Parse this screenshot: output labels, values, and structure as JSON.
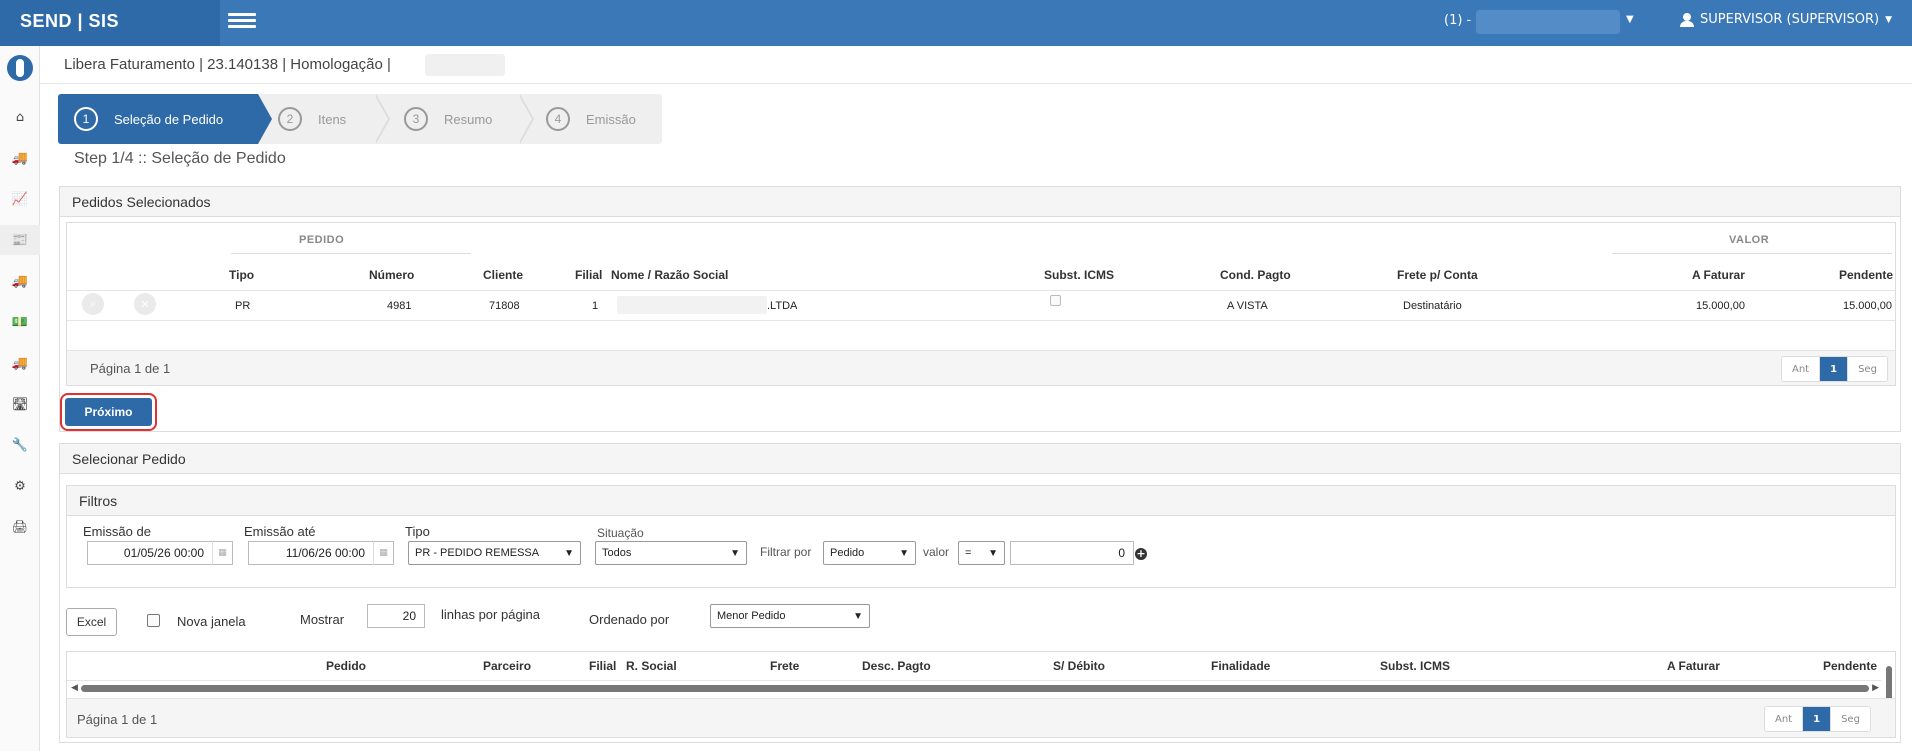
{
  "topbar": {
    "brand": "SEND | SIS",
    "env_prefix": "(1) -",
    "user": "SUPERVISOR (SUPERVISOR)"
  },
  "breadcrumb": "Libera Faturamento | 23.140138 | Homologação |",
  "wizard": {
    "steps": [
      {
        "num": "1",
        "label": "Seleção de Pedido"
      },
      {
        "num": "2",
        "label": "Itens"
      },
      {
        "num": "3",
        "label": "Resumo"
      },
      {
        "num": "4",
        "label": "Emissão"
      }
    ],
    "title": "Step 1/4 :: Seleção de Pedido"
  },
  "selected": {
    "panel_title": "Pedidos Selecionados",
    "group_pedido": "PEDIDO",
    "group_valor": "VALOR",
    "columns": {
      "tipo": "Tipo",
      "numero": "Número",
      "cliente": "Cliente",
      "filial": "Filial",
      "nome": "Nome / Razão Social",
      "subst": "Subst. ICMS",
      "cond": "Cond. Pagto",
      "frete": "Frete p/ Conta",
      "a_faturar": "A Faturar",
      "pendente": "Pendente"
    },
    "row": {
      "tipo": "PR",
      "numero": "4981",
      "cliente": "71808",
      "filial": "1",
      "nome": ".LTDA",
      "cond": "A VISTA",
      "frete": "Destinatário",
      "a_faturar": "15.000,00",
      "pendente": "15.000,00"
    },
    "pagination_text": "Página 1 de 1",
    "pager": {
      "prev": "Ant",
      "current": "1",
      "next": "Seg"
    },
    "next_button": "Próximo"
  },
  "select": {
    "panel_title": "Selecionar Pedido",
    "filters_title": "Filtros",
    "emissao_de_label": "Emissão de",
    "emissao_de_value": "01/05/26 00:00",
    "emissao_ate_label": "Emissão até",
    "emissao_ate_value": "11/06/26 00:00",
    "tipo_label": "Tipo",
    "tipo_value": "PR - PEDIDO REMESSA",
    "situacao_label": "Situação",
    "situacao_value": "Todos",
    "filtrar_label": "Filtrar por",
    "filtrar_value": "Pedido",
    "valor_label": "valor",
    "operator_value": "=",
    "valor_value": "0",
    "excel_button": "Excel",
    "nova_janela": "Nova janela",
    "mostrar_label": "Mostrar",
    "mostrar_value": "20",
    "linhas_label": "linhas por página",
    "ordenado_label": "Ordenado por",
    "ordenado_value": "Menor Pedido",
    "columns": {
      "pedido": "Pedido",
      "parceiro": "Parceiro",
      "filial": "Filial",
      "rsocial": "R. Social",
      "frete": "Frete",
      "desc": "Desc. Pagto",
      "sdebito": "S/ Débito",
      "finalidade": "Finalidade",
      "subst": "Subst. ICMS",
      "a_faturar": "A Faturar",
      "pendente": "Pendente"
    },
    "pagination_text": "Página 1 de 1",
    "pager": {
      "prev": "Ant",
      "current": "1",
      "next": "Seg"
    }
  }
}
